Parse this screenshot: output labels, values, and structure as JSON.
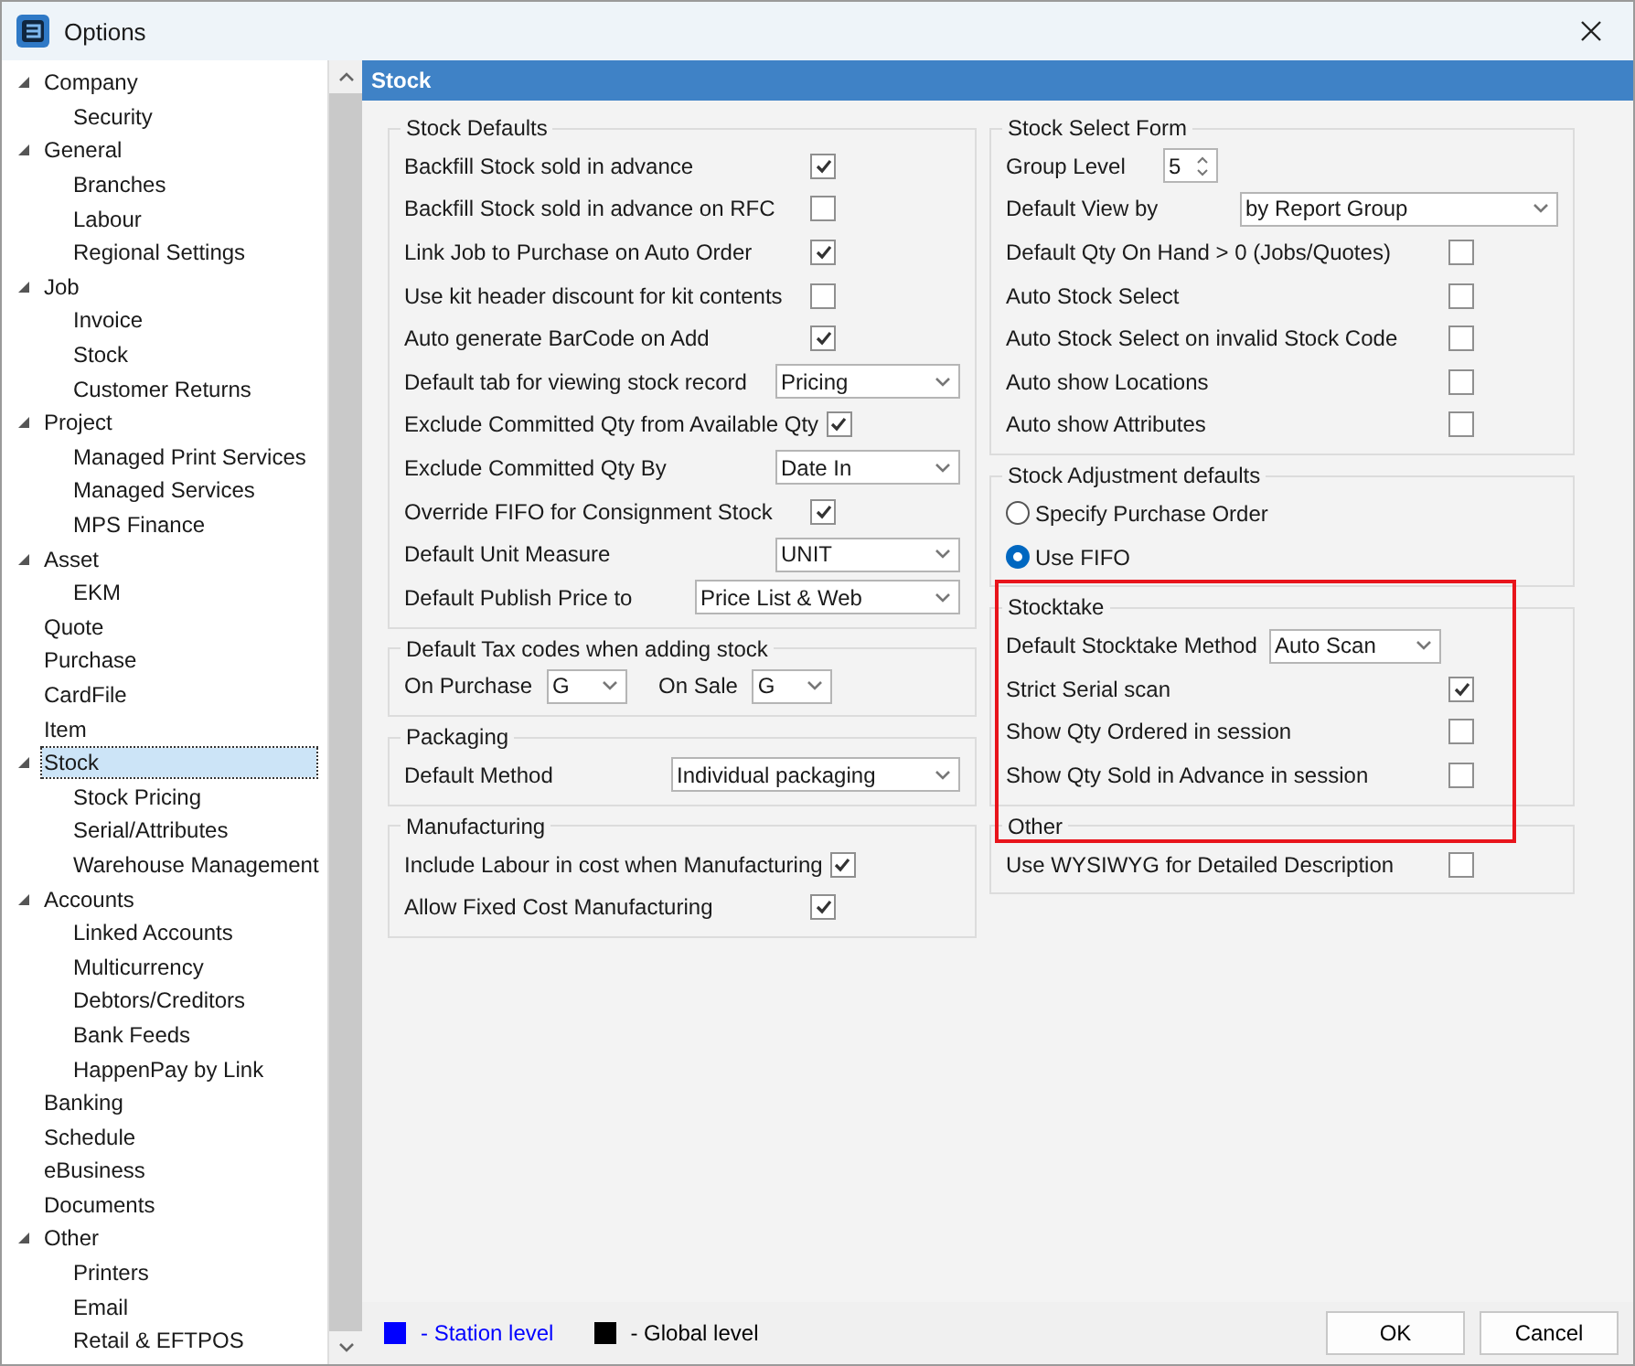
{
  "window": {
    "title": "Options"
  },
  "sidebar": {
    "items": [
      {
        "label": "Company",
        "expanded": true,
        "selected": false,
        "children": [
          {
            "label": "Security",
            "selected": false
          }
        ]
      },
      {
        "label": "General",
        "expanded": true,
        "selected": false,
        "children": [
          {
            "label": "Branches",
            "selected": false
          },
          {
            "label": "Labour",
            "selected": false
          },
          {
            "label": "Regional Settings",
            "selected": false
          }
        ]
      },
      {
        "label": "Job",
        "expanded": true,
        "selected": false,
        "children": [
          {
            "label": "Invoice",
            "selected": false
          },
          {
            "label": "Stock",
            "selected": false
          },
          {
            "label": "Customer Returns",
            "selected": false
          }
        ]
      },
      {
        "label": "Project",
        "expanded": true,
        "selected": false,
        "children": [
          {
            "label": "Managed Print Services",
            "selected": false
          },
          {
            "label": "Managed Services",
            "selected": false
          },
          {
            "label": "MPS Finance",
            "selected": false
          }
        ]
      },
      {
        "label": "Asset",
        "expanded": true,
        "selected": false,
        "children": [
          {
            "label": "EKM",
            "selected": false
          }
        ]
      },
      {
        "label": "Quote",
        "selected": false
      },
      {
        "label": "Purchase",
        "selected": false
      },
      {
        "label": "CardFile",
        "selected": false
      },
      {
        "label": "Item",
        "selected": false
      },
      {
        "label": "Stock",
        "expanded": true,
        "selected": true,
        "children": [
          {
            "label": "Stock Pricing",
            "selected": false
          },
          {
            "label": "Serial/Attributes",
            "selected": false
          },
          {
            "label": "Warehouse Management",
            "selected": false
          }
        ]
      },
      {
        "label": "Accounts",
        "expanded": true,
        "selected": false,
        "children": [
          {
            "label": "Linked Accounts",
            "selected": false
          },
          {
            "label": "Multicurrency",
            "selected": false
          },
          {
            "label": "Debtors/Creditors",
            "selected": false
          },
          {
            "label": "Bank Feeds",
            "selected": false
          },
          {
            "label": "HappenPay by Link",
            "selected": false
          }
        ]
      },
      {
        "label": "Banking",
        "selected": false
      },
      {
        "label": "Schedule",
        "selected": false
      },
      {
        "label": "eBusiness",
        "selected": false
      },
      {
        "label": "Documents",
        "selected": false
      },
      {
        "label": "Other",
        "expanded": true,
        "selected": false,
        "children": [
          {
            "label": "Printers",
            "selected": false
          },
          {
            "label": "Email",
            "selected": false
          },
          {
            "label": "Retail & EFTPOS",
            "selected": false
          }
        ]
      }
    ]
  },
  "header": {
    "title": "Stock"
  },
  "left_sections": [
    {
      "title": "Stock Defaults",
      "highlighted": false,
      "rows": [
        {
          "kind": "checkbox",
          "label": "Backfill Stock sold in advance",
          "checked": true
        },
        {
          "kind": "checkbox",
          "label": "Backfill Stock sold in advance on RFC",
          "checked": false
        },
        {
          "kind": "checkbox",
          "label": "Link Job to Purchase on Auto Order",
          "checked": true
        },
        {
          "kind": "checkbox",
          "label": "Use kit header discount for kit contents",
          "checked": false
        },
        {
          "kind": "checkbox",
          "label": "Auto generate BarCode on Add",
          "checked": true
        },
        {
          "kind": "select",
          "label": "Default tab for viewing stock record",
          "value": "Pricing"
        },
        {
          "kind": "checkbox",
          "label": "Exclude Committed Qty from Available Qty",
          "checked": true
        },
        {
          "kind": "select",
          "label": "Exclude Committed Qty By",
          "value": "Date In"
        },
        {
          "kind": "checkbox",
          "label": "Override FIFO for Consignment Stock",
          "checked": true
        },
        {
          "kind": "select",
          "label": "Default Unit Measure",
          "value": "UNIT"
        },
        {
          "kind": "wide-select",
          "label": "Default Publish Price to",
          "value": "Price List & Web"
        }
      ]
    },
    {
      "title": "Default Tax codes when adding stock",
      "highlighted": false,
      "rows": [
        {
          "kind": "pair",
          "fields": [
            {
              "label": "On Purchase",
              "value": "G"
            },
            {
              "label": "On Sale",
              "value": "G"
            }
          ]
        }
      ]
    },
    {
      "title": "Packaging",
      "highlighted": false,
      "rows": [
        {
          "kind": "wide-select",
          "label": "Default Method",
          "value": "Individual packaging"
        }
      ]
    },
    {
      "title": "Manufacturing",
      "highlighted": false,
      "rows": [
        {
          "kind": "checkbox",
          "label": "Include Labour in cost when Manufacturing",
          "checked": true
        },
        {
          "kind": "checkbox",
          "label": "Allow Fixed Cost Manufacturing",
          "checked": true
        }
      ]
    }
  ],
  "right_sections": [
    {
      "title": "Stock Select Form",
      "highlighted": false,
      "rows": [
        {
          "kind": "spin",
          "label": "Group Level",
          "value": "5"
        },
        {
          "kind": "wide-select",
          "label": "Default View by",
          "value": "by Report Group"
        },
        {
          "kind": "checkbox",
          "label": "Default Qty On Hand > 0 (Jobs/Quotes)",
          "checked": false
        },
        {
          "kind": "checkbox",
          "label": "Auto Stock Select",
          "checked": false
        },
        {
          "kind": "checkbox",
          "label": "Auto Stock Select on invalid Stock Code",
          "checked": false
        },
        {
          "kind": "checkbox",
          "label": "Auto show Locations",
          "checked": false
        },
        {
          "kind": "checkbox",
          "label": "Auto show Attributes",
          "checked": false
        }
      ]
    },
    {
      "title": "Stock Adjustment defaults",
      "highlighted": false,
      "rows": [
        {
          "kind": "radio",
          "label": "Specify Purchase Order",
          "selected": false
        },
        {
          "kind": "radio",
          "label": "Use FIFO",
          "selected": true
        }
      ]
    },
    {
      "title": "Stocktake",
      "highlighted": true,
      "rows": [
        {
          "kind": "select",
          "label": "Default Stocktake Method",
          "value": "Auto Scan"
        },
        {
          "kind": "checkbox",
          "label": "Strict Serial scan",
          "checked": true
        },
        {
          "kind": "checkbox",
          "label": "Show Qty Ordered in session",
          "checked": false
        },
        {
          "kind": "checkbox",
          "label": "Show Qty Sold in Advance in session",
          "checked": false
        }
      ]
    },
    {
      "title": "Other",
      "highlighted": true,
      "rows": [
        {
          "kind": "checkbox",
          "label": "Use WYSIWYG for Detailed Description",
          "checked": false
        }
      ]
    }
  ],
  "legend": [
    {
      "label": "- Station level",
      "color": "#0000ff"
    },
    {
      "label": "- Global level",
      "color": "#000000"
    }
  ],
  "buttons": [
    "OK",
    "Cancel"
  ]
}
